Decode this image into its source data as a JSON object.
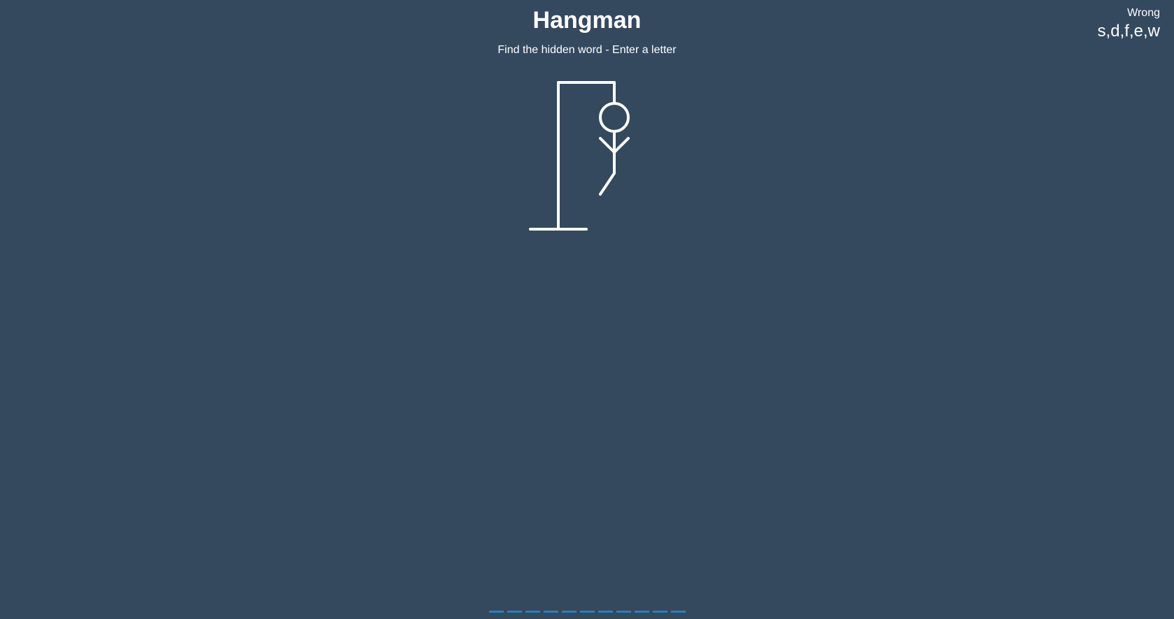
{
  "game": {
    "title": "Hangman",
    "instructions": "Find the hidden word - Enter a letter",
    "stage": "6 of 6"
  },
  "wrong": {
    "label": "Wrong",
    "letters_display": "s,d,f,e,w",
    "letters": [
      "s",
      "d",
      "f",
      "e",
      "w"
    ],
    "count": 5
  },
  "word": {
    "length": 11,
    "revealed": [
      "",
      "",
      "",
      "",
      "",
      "",
      "",
      "",
      "",
      "",
      ""
    ]
  },
  "figure": {
    "parts_shown": [
      "head",
      "body",
      "left-arm",
      "right-arm",
      "left-leg"
    ],
    "parts_hidden": [
      "right-leg"
    ]
  },
  "colors": {
    "background": "#34495e",
    "figure": "#ffffff",
    "text": "#ffffff",
    "letter_slot": "#2980b9"
  }
}
